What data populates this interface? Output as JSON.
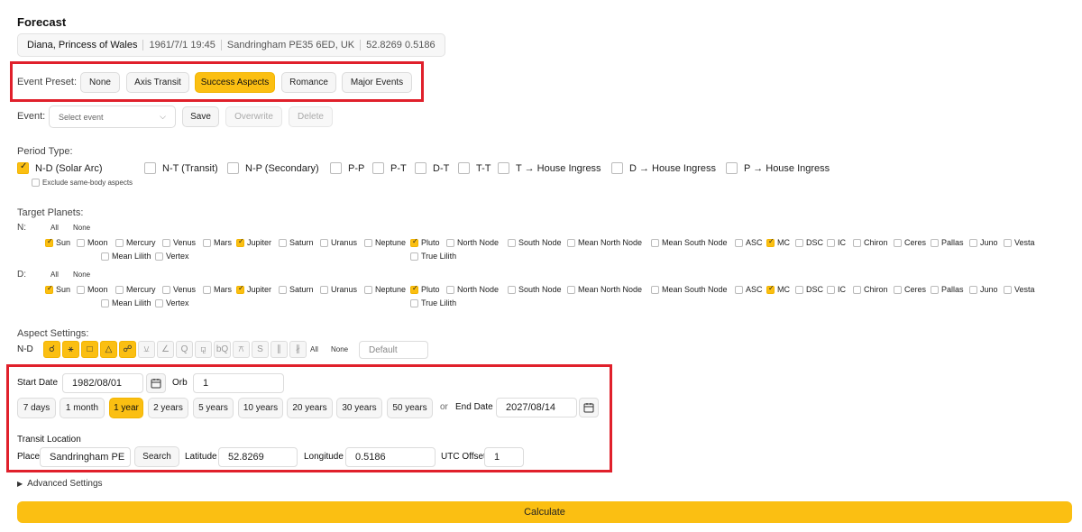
{
  "header": {
    "title": "Forecast"
  },
  "person": {
    "name": "Diana, Princess of Wales",
    "datetime": "1961/7/1 19:45",
    "place": "Sandringham PE35 6ED, UK",
    "coords": "52.8269 0.5186"
  },
  "preset": {
    "label": "Event Preset:",
    "buttons": [
      "None",
      "Axis Transit",
      "Success Aspects",
      "Romance",
      "Major Events"
    ],
    "active": "Success Aspects"
  },
  "event": {
    "label": "Event:",
    "placeholder": "Select event",
    "save": "Save",
    "overwrite": "Overwrite",
    "delete": "Delete"
  },
  "period": {
    "label": "Period Type:",
    "options": [
      "N-D (Solar Arc)",
      "N-T (Transit)",
      "N-P (Secondary)",
      "P-P",
      "P-T",
      "D-T",
      "T-T",
      "T → House Ingress",
      "D → House Ingress",
      "P → House Ingress"
    ],
    "checked": [
      "N-D (Solar Arc)"
    ],
    "exclude": "Exclude same-body aspects"
  },
  "planets": {
    "label": "Target Planets:",
    "all": "All",
    "none": "None",
    "rows": [
      {
        "key": "N:",
        "checked": [
          "Sun",
          "Jupiter",
          "Pluto",
          "MC"
        ]
      },
      {
        "key": "D:",
        "checked": [
          "Sun",
          "Jupiter",
          "Pluto",
          "MC"
        ]
      }
    ],
    "names": [
      "Sun",
      "Moon",
      "Mercury",
      "Venus",
      "Mars",
      "Jupiter",
      "Saturn",
      "Uranus",
      "Neptune",
      "Pluto",
      "North Node",
      "South Node",
      "Mean North Node",
      "Mean South Node",
      "ASC",
      "MC",
      "DSC",
      "IC",
      "Chiron",
      "Ceres",
      "Pallas",
      "Juno",
      "Vesta",
      "True Lilith",
      "Mean Lilith",
      "Vertex"
    ]
  },
  "aspects": {
    "label": "Aspect Settings:",
    "row_label": "N-D",
    "icons": [
      {
        "name": "conjunction-icon",
        "glyph": "☌",
        "on": true
      },
      {
        "name": "sextile-icon",
        "glyph": "⚹",
        "on": true
      },
      {
        "name": "square-icon",
        "glyph": "□",
        "on": true
      },
      {
        "name": "trine-icon",
        "glyph": "△",
        "on": true
      },
      {
        "name": "opposition-icon",
        "glyph": "☍",
        "on": true
      },
      {
        "name": "semisextile-icon",
        "glyph": "⚺",
        "on": false
      },
      {
        "name": "semisquare-icon",
        "glyph": "∠",
        "on": false
      },
      {
        "name": "quintile-icon",
        "glyph": "Q",
        "on": false
      },
      {
        "name": "sesquiquadrate-icon",
        "glyph": "⚼",
        "on": false
      },
      {
        "name": "biquintile-icon",
        "glyph": "bQ",
        "on": false
      },
      {
        "name": "quincunx-icon",
        "glyph": "⚻",
        "on": false
      },
      {
        "name": "septile-icon",
        "glyph": "S",
        "on": false
      },
      {
        "name": "parallel-icon",
        "glyph": "∥",
        "on": false
      },
      {
        "name": "contraparallel-icon",
        "glyph": "∦",
        "on": false
      }
    ],
    "all": "All",
    "none": "None",
    "default_placeholder": "Default"
  },
  "dates": {
    "start_label": "Start Date",
    "start_value": "1982/08/01",
    "orb_label": "Orb",
    "orb_value": "1",
    "ranges": [
      "7 days",
      "1 month",
      "1 year",
      "2 years",
      "5 years",
      "10 years",
      "20 years",
      "30 years",
      "50 years"
    ],
    "active_range": "1 year",
    "or": "or",
    "end_label": "End Date",
    "end_value": "2027/08/14"
  },
  "location": {
    "label": "Transit Location",
    "place_label": "Place",
    "place_value": "Sandringham PE",
    "search": "Search",
    "lat_label": "Latitude",
    "lat_value": "52.8269",
    "lon_label": "Longitude",
    "lon_value": "0.5186",
    "utc_label": "UTC Offset",
    "utc_value": "1"
  },
  "advanced": {
    "label": "Advanced Settings"
  },
  "calculate": {
    "label": "Calculate"
  },
  "colors": {
    "accent": "#fbbf12",
    "highlight": "#e0202b"
  }
}
